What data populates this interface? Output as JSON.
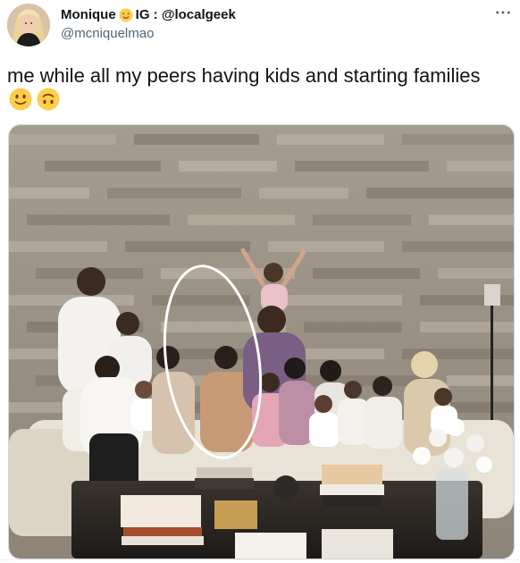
{
  "tweet": {
    "author": {
      "name": "Monique",
      "name_suffix": "IG : @localgeek",
      "handle": "@mcniquelmao",
      "avatar_icon": "profile-photo"
    },
    "text": "me while all my peers having kids and starting families",
    "emojis": [
      "slightly-smiling-face",
      "upside-down-face"
    ],
    "more_icon": "more-options-icon",
    "photo": {
      "description_icon": "group-photo",
      "accent_circle_color": "#ffffff"
    }
  }
}
